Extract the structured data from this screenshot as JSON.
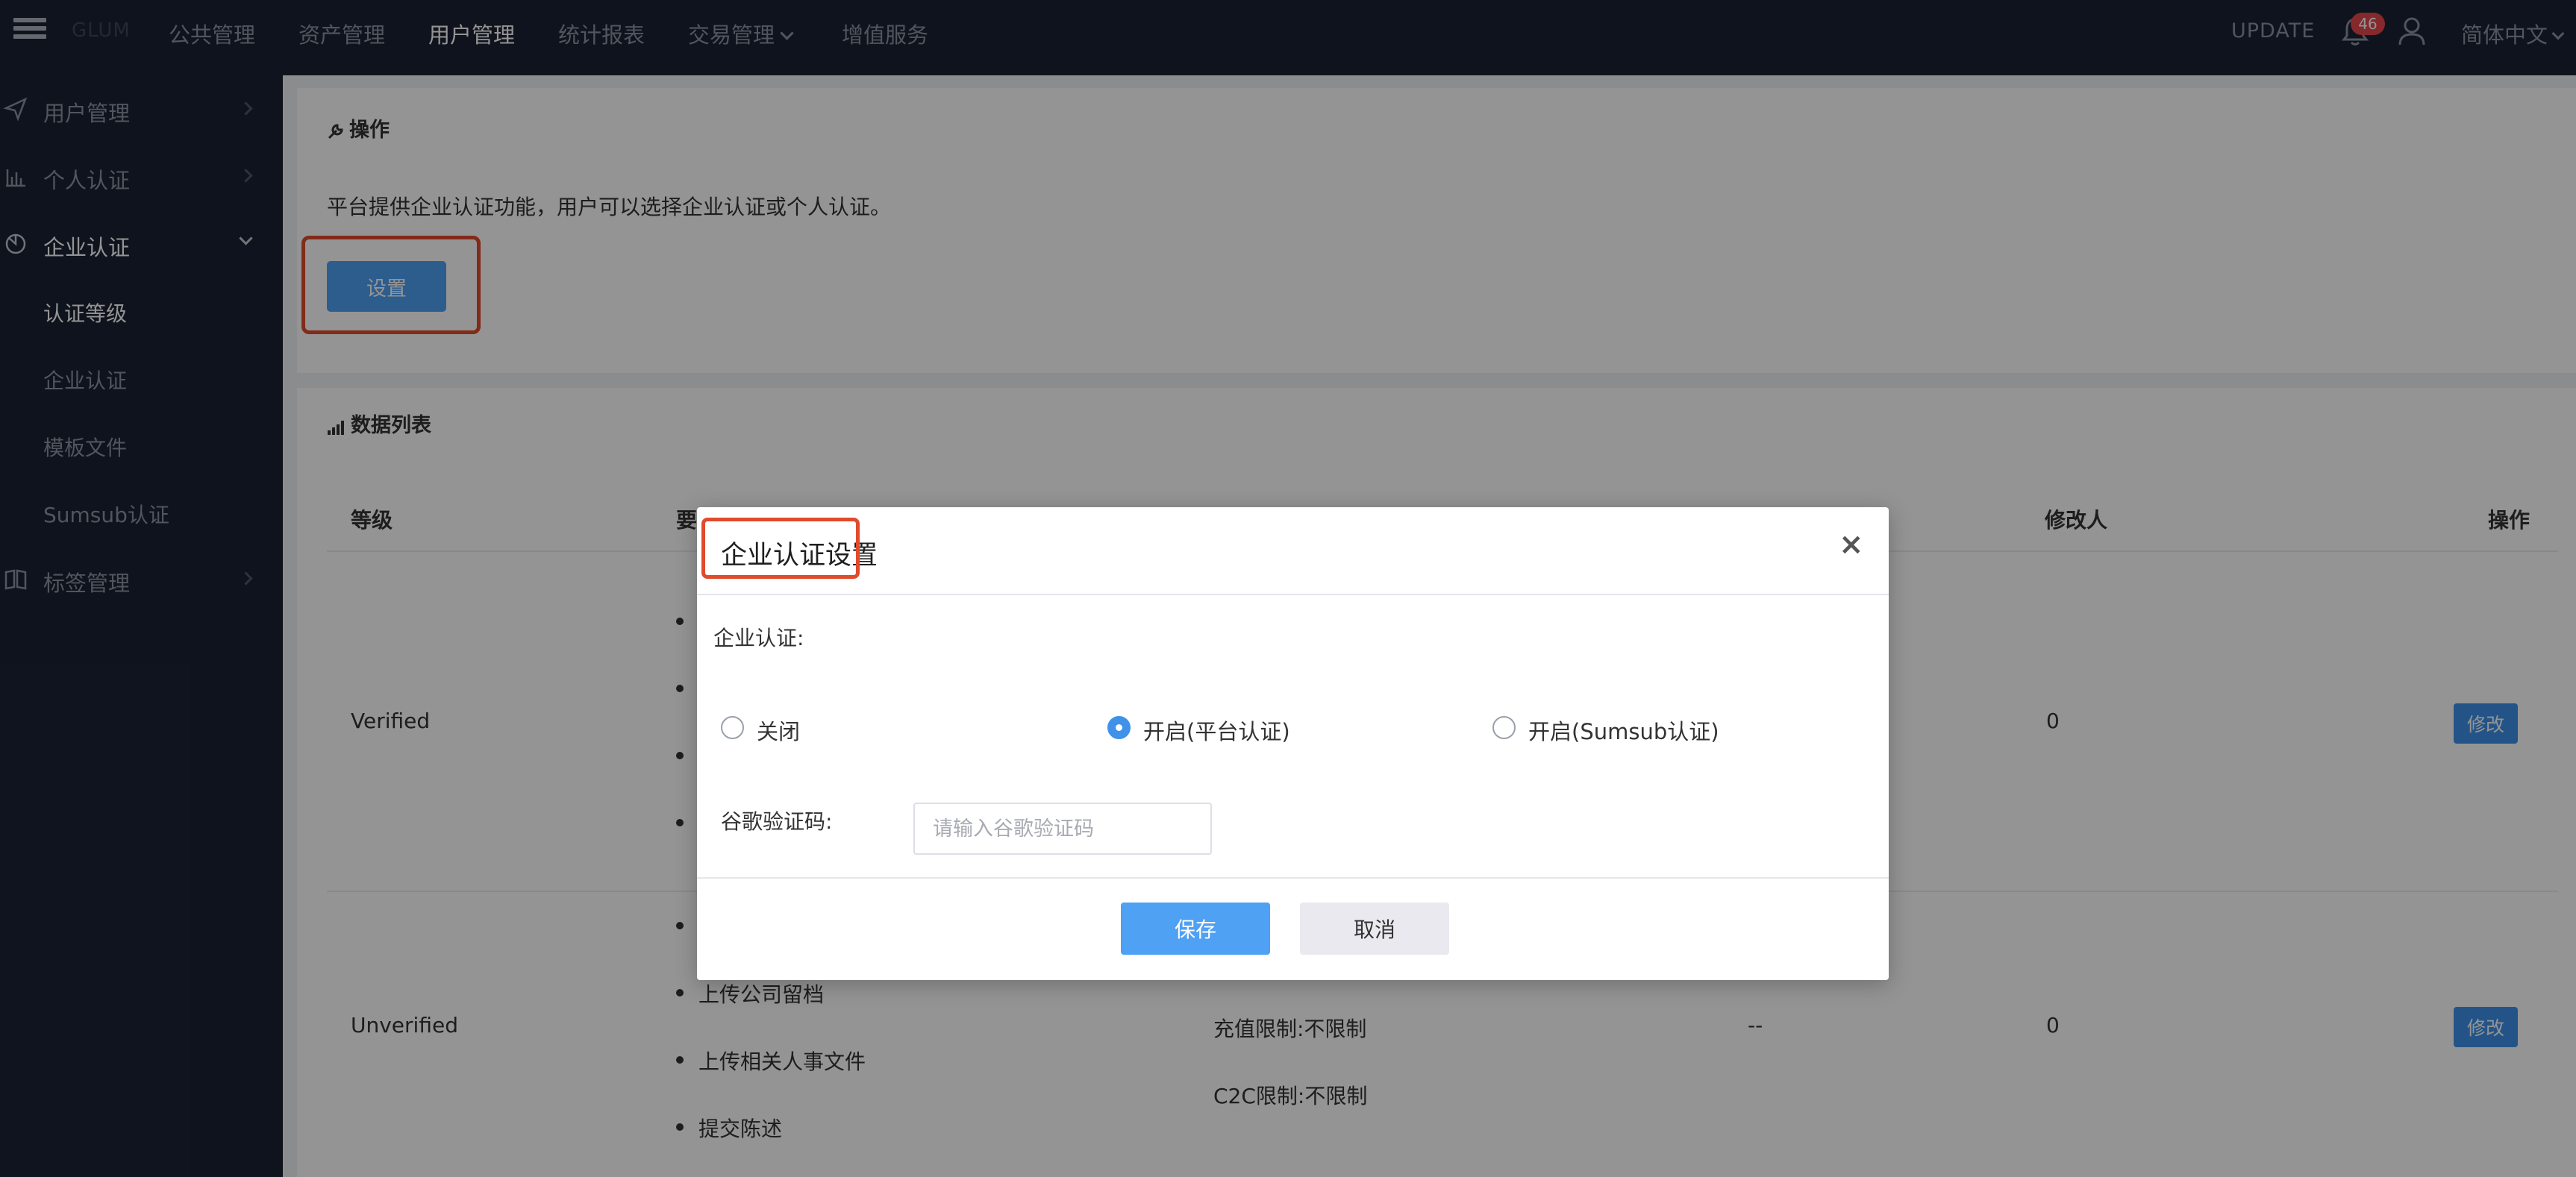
{
  "header": {
    "brand": "GLUM",
    "nav": [
      "公共管理",
      "资产管理",
      "用户管理",
      "统计报表",
      "交易管理",
      "增值服务"
    ],
    "update_label": "UPDATE",
    "notification_count": "46",
    "language": "简体中文"
  },
  "sidebar": {
    "items": [
      "用户管理",
      "个人认证",
      "企业认证",
      "标签管理"
    ],
    "sub_items": [
      "认证等级",
      "企业认证",
      "模板文件",
      "Sumsub认证"
    ]
  },
  "operation": {
    "title": "操作",
    "description": "平台提供企业认证功能，用户可以选择企业认证或个人认证。",
    "settings_button": "设置"
  },
  "data_list": {
    "title": "数据列表",
    "columns": {
      "level": "等级",
      "requirement": "要",
      "modifier": "修改人",
      "action": "操作"
    },
    "rows": [
      {
        "level": "Verified",
        "modifier": "0",
        "edit_label": "修改"
      },
      {
        "level": "Unverified",
        "requirements": [
          "上传公司留档",
          "上传相关人事文件",
          "提交陈述"
        ],
        "limits": [
          "充值限制:不限制",
          "C2C限制:不限制"
        ],
        "extra": "--",
        "modifier": "0",
        "edit_label": "修改"
      }
    ]
  },
  "modal": {
    "title": "企业认证设置",
    "close": "×",
    "field_label": "企业认证:",
    "options": [
      "关闭",
      "开启(平台认证)",
      "开启(Sumsub认证)"
    ],
    "selected_option": "开启(平台认证)",
    "code_label": "谷歌验证码:",
    "code_placeholder": "请输入谷歌验证码",
    "save_label": "保存",
    "cancel_label": "取消"
  },
  "colors": {
    "primary": "#4ea1f3",
    "highlight": "#e04b2c",
    "sidebar_bg": "#1b2233"
  }
}
